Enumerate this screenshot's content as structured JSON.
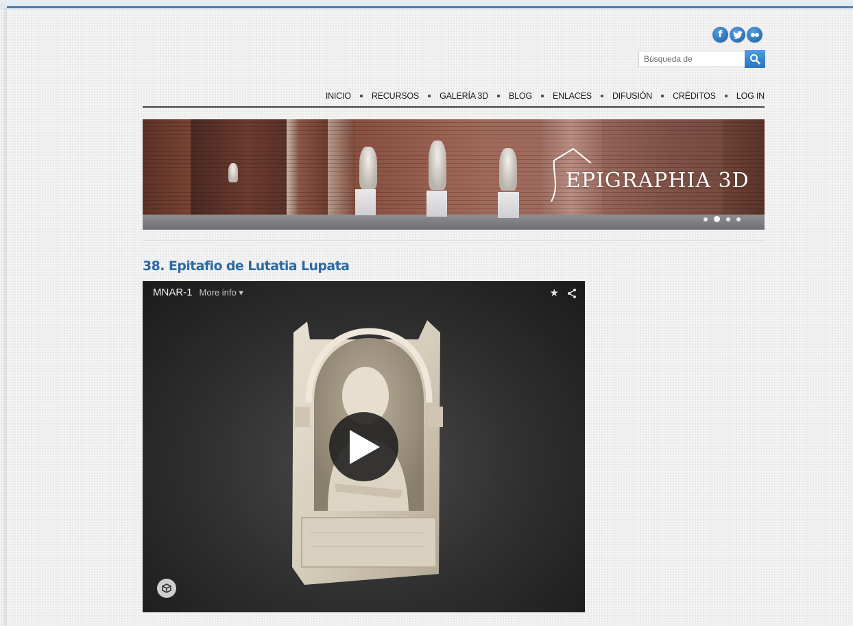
{
  "social": {
    "facebook": "f",
    "twitter": "twitter-icon",
    "flickr": "flickr-icon"
  },
  "search": {
    "placeholder": "Búsqueda de",
    "value": ""
  },
  "nav": {
    "items": [
      {
        "label": "INICIO"
      },
      {
        "label": "RECURSOS"
      },
      {
        "label": "GALERÍA 3D"
      },
      {
        "label": "BLOG"
      },
      {
        "label": "ENLACES"
      },
      {
        "label": "DIFUSIÓN"
      },
      {
        "label": "CRÉDITOS"
      },
      {
        "label": "LOG IN"
      }
    ]
  },
  "banner": {
    "logo_text": "EPIGRAPHIA 3D",
    "slide_count": 4,
    "active_slide": 2
  },
  "article": {
    "title": "38. Epitafio de Lutatia Lupata"
  },
  "viewer": {
    "model_name": "MNAR-1",
    "more_info": "More info",
    "more_info_caret": "▾",
    "star": "★",
    "share": "<"
  },
  "colors": {
    "accent": "#2d6aa3",
    "topbar": "#4f86b8",
    "social": "#2a6fb5"
  }
}
